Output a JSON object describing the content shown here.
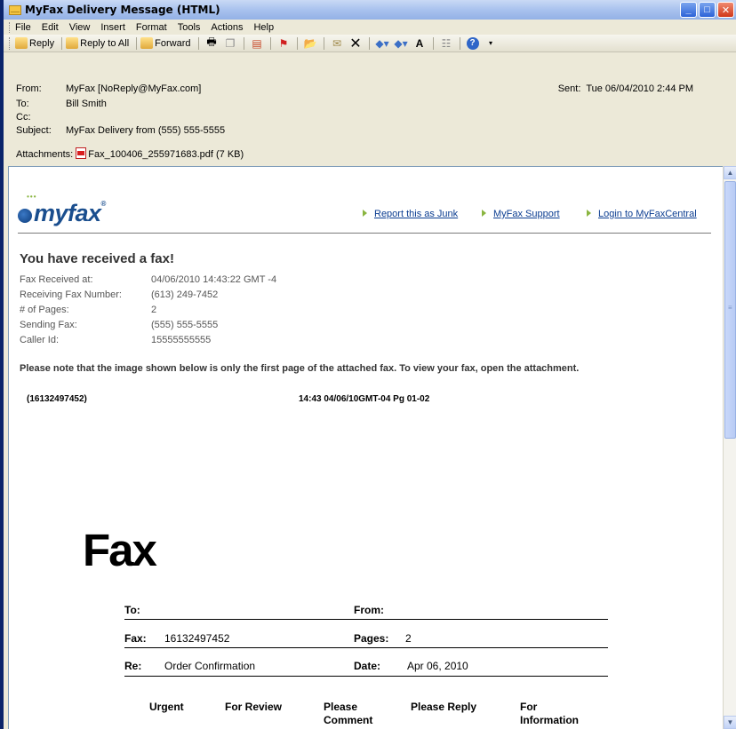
{
  "window": {
    "title": "MyFax Delivery  Message (HTML)"
  },
  "menu": [
    "File",
    "Edit",
    "View",
    "Insert",
    "Format",
    "Tools",
    "Actions",
    "Help"
  ],
  "toolbar": {
    "reply": "Reply",
    "reply_all": "Reply to All",
    "forward": "Forward"
  },
  "header": {
    "from_label": "From:",
    "from_value": "MyFax [NoReply@MyFax.com]",
    "to_label": "To:",
    "to_value": "Bill Smith",
    "cc_label": "Cc:",
    "cc_value": "",
    "subject_label": "Subject:",
    "subject_value": "MyFax Delivery from (555) 555-5555",
    "attachments_label": "Attachments:",
    "attachment_file": "Fax_100406_255971683.pdf (7 KB)",
    "sent_label": "Sent:",
    "sent_value": "Tue 06/04/2010 2:44 PM"
  },
  "email": {
    "logo": "myfax",
    "logo_reg": "®",
    "links": [
      "Report this as Junk",
      "MyFax Support",
      "Login to MyFaxCentral"
    ],
    "heading": "You have received a fax!",
    "details": [
      {
        "label": "Fax Received at:",
        "value": "04/06/2010 14:43:22 GMT -4"
      },
      {
        "label": "Receiving Fax Number:",
        "value": "(613) 249-7452"
      },
      {
        "label": "# of Pages:",
        "value": "2"
      },
      {
        "label": "Sending Fax:",
        "value": "(555) 555-5555"
      },
      {
        "label": "Caller Id:",
        "value": "15555555555"
      }
    ],
    "note": "Please note that the image shown below is only the first page of the attached fax. To view your fax, open the attachment.",
    "fax_header_left": "(16132497452)",
    "fax_header_right": "14:43 04/06/10GMT-04 Pg 01-02"
  },
  "fax_page": {
    "big_title": "Fax",
    "to_label": "To:",
    "to_value": "",
    "from_label": "From:",
    "from_value": "",
    "fax_label": "Fax:",
    "fax_value": "16132497452",
    "pages_label": "Pages:",
    "pages_value": "2",
    "re_label": "Re:",
    "re_value": "Order Confirmation",
    "date_label": "Date:",
    "date_value": "Apr 06, 2010",
    "options": [
      "Urgent",
      "For Review",
      "Please Comment",
      "Please Reply",
      "For Information"
    ]
  }
}
